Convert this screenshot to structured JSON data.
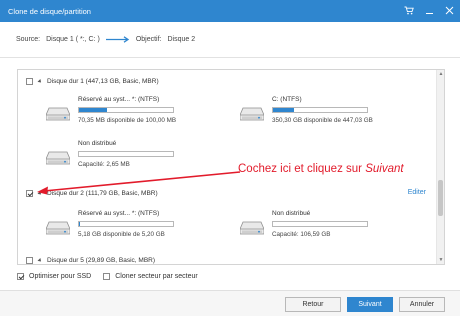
{
  "window": {
    "title": "Clone de disque/partition"
  },
  "source_bar": {
    "source_label": "Source:",
    "source_value": "Disque 1 ( *:, C: )",
    "target_label": "Objectif:",
    "target_value": "Disque 2"
  },
  "disks": [
    {
      "header": "Disque dur 1 (447,13 GB, Basic, MBR)",
      "checked": false,
      "partitions": [
        {
          "name": "Réservé au syst... *: (NTFS)",
          "info": "70,35 MB disponible de 100,00 MB",
          "usage_fraction": 0.3
        },
        {
          "name": "C: (NTFS)",
          "info": "350,30 GB disponible de 447,03 GB",
          "usage_fraction": 0.22
        },
        {
          "name": "Non distribué",
          "info": "Capacité: 2,65 MB",
          "usage_fraction": 0
        }
      ]
    },
    {
      "header": "Disque dur 2 (111,79 GB, Basic, MBR)",
      "checked": true,
      "edit_label": "Editer",
      "partitions": [
        {
          "name": "Réservé au syst... *: (NTFS)",
          "info": "5,18 GB disponible de 5,20 GB",
          "usage_fraction": 0.01
        },
        {
          "name": "Non distribué",
          "info": "Capacité: 106,59 GB",
          "usage_fraction": 0
        }
      ]
    },
    {
      "header": "Disque dur 5 (29,89 GB, Basic, MBR)",
      "checked": false
    }
  ],
  "annotation": {
    "text": "Cochez ici et cliquez sur ",
    "emphasis": "Suivant"
  },
  "options": {
    "ssd_label": "Optimiser pour SSD",
    "ssd_checked": true,
    "sector_label": "Cloner secteur par secteur",
    "sector_checked": false
  },
  "buttons": {
    "back": "Retour",
    "next": "Suivant",
    "cancel": "Annuler"
  },
  "colors": {
    "accent": "#2f86cf",
    "annotation": "#e21b2b"
  }
}
